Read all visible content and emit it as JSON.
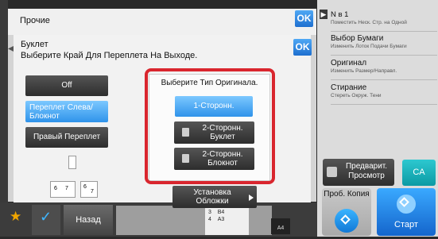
{
  "main_dialog": {
    "title": "Прочие",
    "ok_label": "OK"
  },
  "booklet_dialog": {
    "title": "Буклет",
    "subtitle": "Выберите Край Для Переплета На Выходе.",
    "ok_label": "OK",
    "binding_options": [
      {
        "label": "Off",
        "selected": false
      },
      {
        "label": "Переплет Слева/ Блокнот",
        "selected": true
      },
      {
        "label": "Правый Переплет",
        "selected": false
      }
    ],
    "original_type": {
      "prompt": "Выберите Тип Оригинала.",
      "options": [
        {
          "label": "1-Сторонн.",
          "selected": true
        },
        {
          "label": "2-Сторонн. Буклет",
          "selected": false
        },
        {
          "label": "2-Сторонн. Блокнот",
          "selected": false
        }
      ]
    },
    "cover_button": "Установка Обложки",
    "preview_pages": [
      "6",
      "7",
      "6",
      "7"
    ]
  },
  "side_panel": {
    "items": [
      {
        "title": "N в 1",
        "sub": "Поместить Неск. Стр. на Одной"
      },
      {
        "title": "Выбор Бумаги",
        "sub": "Изменить Лоток Подачи Бумаги"
      },
      {
        "title": "Оригинал",
        "sub": "Изменить Размер/Направл."
      },
      {
        "title": "Стирание",
        "sub": "Стереть Окруж. Тени"
      }
    ],
    "preview_button": "Предварит. Просмотр",
    "ca_button": "CA",
    "proof_copy_button": "Проб. Копия",
    "start_button": "Старт"
  },
  "bottom_bar": {
    "back_button": "Назад",
    "paper_rows": [
      {
        "num": "3",
        "size": "B4"
      },
      {
        "num": "4",
        "size": "A3"
      }
    ],
    "paper_size": "A4"
  },
  "colors": {
    "accent_blue": "#2f93ea",
    "highlight_red": "#d9262e",
    "ca_teal": "#15a8b2",
    "star_orange": "#f0a500"
  }
}
